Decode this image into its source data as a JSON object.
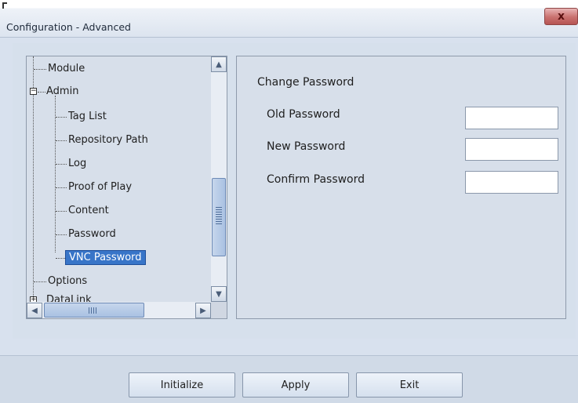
{
  "window": {
    "title": "Configuration - Advanced",
    "close_label": "x"
  },
  "tree": {
    "nodes": [
      {
        "label": "Module"
      },
      {
        "label": "Admin",
        "expander": "−"
      },
      {
        "label": "Tag List"
      },
      {
        "label": "Repository Path"
      },
      {
        "label": "Log"
      },
      {
        "label": "Proof of Play"
      },
      {
        "label": "Content"
      },
      {
        "label": "Password"
      },
      {
        "label": "VNC Password",
        "selected": true
      },
      {
        "label": "Options"
      },
      {
        "label": "DataLink",
        "expander": "+"
      }
    ],
    "scroll_up": "▲",
    "scroll_down": "▼",
    "scroll_left": "◀",
    "scroll_right": "▶"
  },
  "form": {
    "section_title": "Change Password",
    "old_password_label": "Old Password",
    "new_password_label": "New Password",
    "confirm_password_label": "Confirm Password",
    "old_password_value": "",
    "new_password_value": "",
    "confirm_password_value": ""
  },
  "buttons": {
    "initialize": "Initialize",
    "apply": "Apply",
    "exit": "Exit"
  }
}
